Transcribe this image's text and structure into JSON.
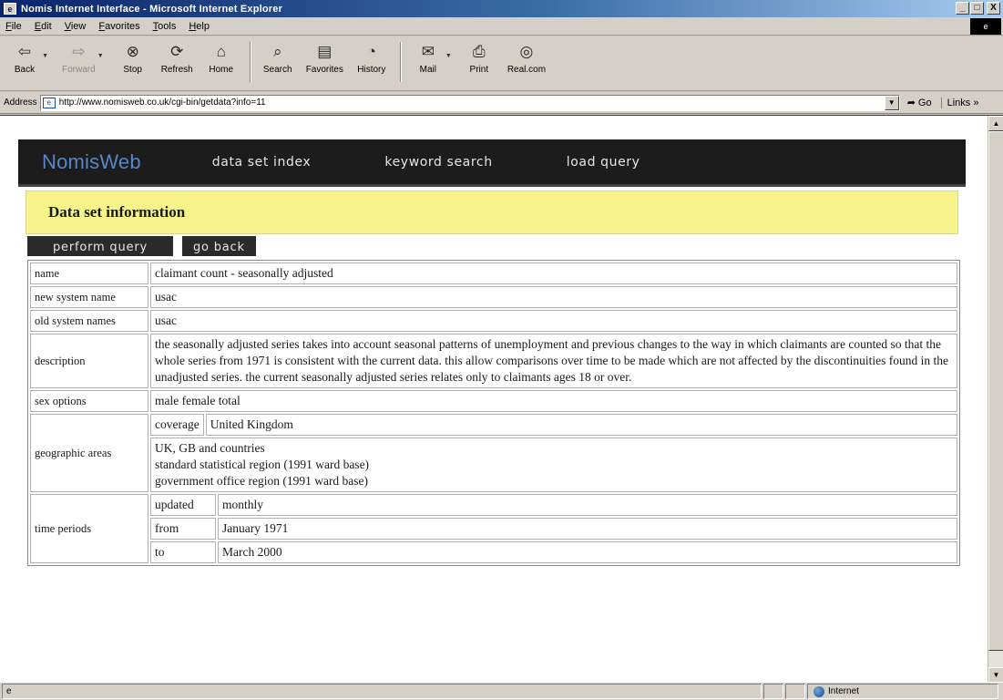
{
  "window": {
    "title": "Nomis Internet Interface - Microsoft Internet Explorer",
    "controls": [
      "_",
      "□",
      "X"
    ]
  },
  "menu": [
    "File",
    "Edit",
    "View",
    "Favorites",
    "Tools",
    "Help"
  ],
  "toolbar": {
    "buttons": [
      {
        "label": "Back",
        "icon": "back-arrow-icon",
        "glyph": "⇦"
      },
      {
        "label": "Forward",
        "icon": "forward-arrow-icon",
        "glyph": "⇨"
      },
      {
        "label": "Stop",
        "icon": "stop-icon",
        "glyph": "⊗"
      },
      {
        "label": "Refresh",
        "icon": "refresh-icon",
        "glyph": "⟳"
      },
      {
        "label": "Home",
        "icon": "home-icon",
        "glyph": "⌂"
      },
      {
        "label": "Search",
        "icon": "search-icon",
        "glyph": "⌕"
      },
      {
        "label": "Favorites",
        "icon": "favorites-icon",
        "glyph": "▤"
      },
      {
        "label": "History",
        "icon": "history-icon",
        "glyph": "◔"
      },
      {
        "label": "Mail",
        "icon": "mail-icon",
        "glyph": "✉"
      },
      {
        "label": "Print",
        "icon": "print-icon",
        "glyph": "⎙"
      },
      {
        "label": "Real.com",
        "icon": "realcom-icon",
        "glyph": "◎"
      }
    ]
  },
  "address": {
    "label": "Address",
    "url": "http://www.nomisweb.co.uk/cgi-bin/getdata?info=11",
    "go": "Go",
    "links": "Links"
  },
  "site": {
    "logo": "NomisWeb",
    "nav": [
      "data set index",
      "keyword search",
      "load query"
    ],
    "heading": "Data set information",
    "actions": [
      "perform query",
      "go back"
    ]
  },
  "dataset": {
    "name_label": "name",
    "name": "claimant count - seasonally adjusted",
    "new_system_name_label": "new system name",
    "new_system_name": "usac",
    "old_system_names_label": "old system names",
    "old_system_names": "usac",
    "description_label": "description",
    "description": "the seasonally adjusted series takes into account seasonal patterns of unemployment and previous changes to the way in which claimants are counted so that the whole series from 1971 is consistent with the current data. this allow comparisons over time to be made which are not affected by the discontinuities found in the unadjusted series. the current seasonally adjusted series relates only to claimants ages 18 or over.",
    "sex_options_label": "sex options",
    "sex_options": "male female total",
    "geographic_areas_label": "geographic areas",
    "coverage_label": "coverage",
    "coverage": "United Kingdom",
    "areas": [
      "UK, GB and countries",
      "standard statistical region (1991 ward base)",
      "government office region (1991 ward base)"
    ],
    "time_periods_label": "time periods",
    "updated_label": "updated",
    "updated": "monthly",
    "from_label": "from",
    "from": "January 1971",
    "to_label": "to",
    "to": "March 2000"
  },
  "status": {
    "zone": "Internet"
  }
}
